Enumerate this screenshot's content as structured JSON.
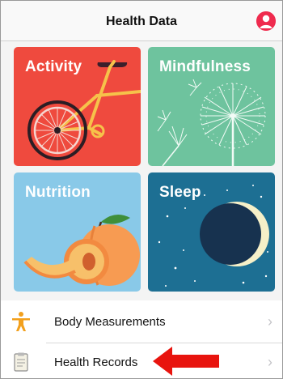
{
  "header": {
    "title": "Health Data",
    "profile_icon": "profile-icon"
  },
  "categories": [
    {
      "label": "Activity",
      "color": "#ef4a3e",
      "icon": "bicycle-icon"
    },
    {
      "label": "Mindfulness",
      "color": "#6ec39e",
      "icon": "dandelion-icon"
    },
    {
      "label": "Nutrition",
      "color": "#89c9e8",
      "icon": "peach-icon"
    },
    {
      "label": "Sleep",
      "color": "#1d6f93",
      "icon": "moon-icon"
    }
  ],
  "list": [
    {
      "label": "Body Measurements",
      "icon": "body-figure-icon",
      "icon_color": "#f2a01d"
    },
    {
      "label": "Health Records",
      "icon": "clipboard-icon"
    }
  ],
  "annotation": {
    "color": "#e8140e",
    "points_to": "Health Records"
  }
}
